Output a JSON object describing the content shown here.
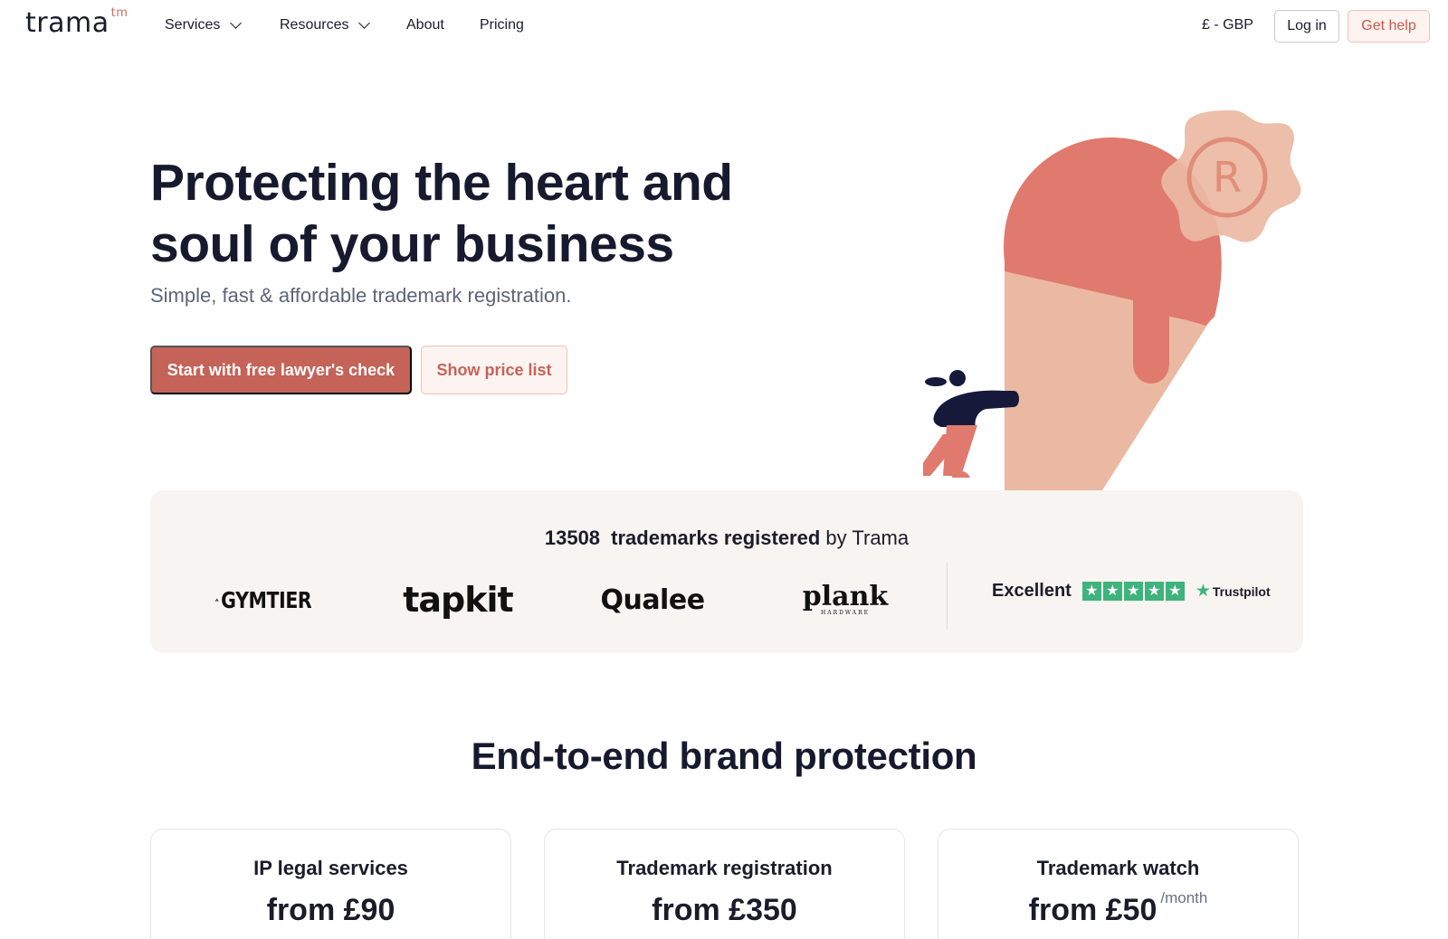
{
  "nav": {
    "logo_text": "trama",
    "logo_sup": "tm",
    "items": [
      {
        "label": "Services"
      },
      {
        "label": "Resources"
      },
      {
        "label": "About"
      },
      {
        "label": "Pricing"
      }
    ],
    "currency": "£ - GBP",
    "login": "Log in",
    "help": "Get help"
  },
  "hero": {
    "title": "Protecting the heart and soul of your business",
    "subtitle": "Simple, fast & affordable trademark registration.",
    "primary_cta": "Start with free lawyer's check",
    "secondary_cta": "Show price list",
    "badge_letter": "R"
  },
  "stats": {
    "count": "13508",
    "label_bold": "trademarks registered",
    "label_rest": "by Trama",
    "brands": [
      {
        "name": "GYMTIER"
      },
      {
        "name": "tapkit"
      },
      {
        "name": "Qualee"
      },
      {
        "name": "plank",
        "tagline": "HARDWARE"
      }
    ],
    "trustpilot": {
      "rating_text": "Excellent",
      "stars": 5,
      "brand": "Trustpilot"
    }
  },
  "section": {
    "title": "End-to-end brand protection",
    "cards": [
      {
        "title": "IP legal services",
        "price": "from £90",
        "period": ""
      },
      {
        "title": "Trademark registration",
        "price": "from £350",
        "period": ""
      },
      {
        "title": "Trademark watch",
        "price": "from £50",
        "period": "/month"
      }
    ]
  },
  "colors": {
    "accent": "#c56358",
    "accent_light": "#fdf3f0",
    "illustration_red": "#e07a6e",
    "illustration_peach": "#ebb9a2",
    "figure_navy": "#16193a",
    "trustpilot_green": "#3eb37d"
  }
}
